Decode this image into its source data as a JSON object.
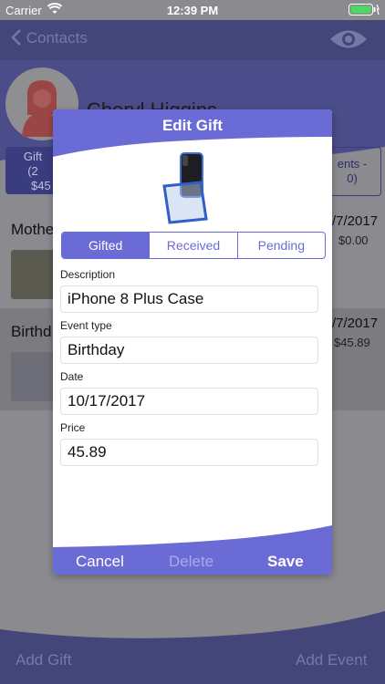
{
  "status": {
    "carrier": "Carrier",
    "time": "12:39 PM"
  },
  "nav": {
    "back_label": "Contacts"
  },
  "contact": {
    "name": "Cheryl Higgins"
  },
  "summary_tabs": {
    "left_lines": [
      "Gift",
      "(2",
      "$45"
    ],
    "right_lines": [
      "ents -",
      "0)"
    ]
  },
  "events": [
    {
      "title": "Mothe",
      "date": "/7/2017",
      "price": "$0.00"
    },
    {
      "title": "Birthd",
      "date": "/7/2017",
      "price": "$45.89"
    }
  ],
  "bottom": {
    "add_gift": "Add Gift",
    "add_event": "Add Event"
  },
  "dialog": {
    "title": "Edit Gift",
    "segments": [
      "Gifted",
      "Received",
      "Pending"
    ],
    "description_label": "Description",
    "description_value": "iPhone 8 Plus Case",
    "event_type_label": "Event type",
    "event_type_value": "Birthday",
    "date_label": "Date",
    "date_value": "10/17/2017",
    "price_label": "Price",
    "price_value": "45.89",
    "cancel_label": "Cancel",
    "delete_label": "Delete",
    "save_label": "Save"
  },
  "colors": {
    "accent": "#6b6bd6",
    "nav_dimmed": "#44467a",
    "overlay_bg": "#8a8a8f"
  }
}
